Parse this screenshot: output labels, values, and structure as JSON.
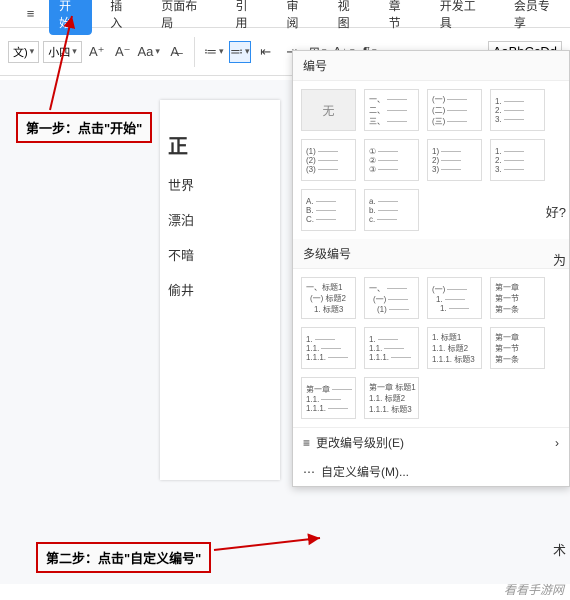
{
  "tabs": {
    "items": [
      "开始",
      "插入",
      "页面布局",
      "引用",
      "审阅",
      "视图",
      "章节",
      "开发工具",
      "会员专享"
    ],
    "active_index": 0
  },
  "ribbon": {
    "font_marker": "文)",
    "font_size": "小四",
    "increase_font": "A⁺",
    "decrease_font": "A⁻",
    "clear_format": "A",
    "style_preview": "AaBbCcDd"
  },
  "document": {
    "title_fragment": "正",
    "lines": [
      "世界",
      "漂泊",
      "不暗",
      "偷井"
    ],
    "right_fragments": [
      "好?",
      "为",
      "术"
    ]
  },
  "callouts": {
    "step1": "第一步：点击\"开始\"",
    "step2": "第二步：点击\"自定义编号\""
  },
  "panel": {
    "section1_title": "编号",
    "none_label": "无",
    "section2_title": "多级编号",
    "footer_change_level": "更改编号级别(E)",
    "footer_custom": "自定义编号(M)...",
    "thumbs_row1": [
      [
        "一、",
        "二、",
        "三、"
      ],
      [
        "(一)",
        "(二)",
        "(三)"
      ],
      [
        "1.",
        "2.",
        "3."
      ]
    ],
    "thumbs_row2": [
      [
        "(1)",
        "(2)",
        "(3)"
      ],
      [
        "①",
        "②",
        "③"
      ],
      [
        "1)",
        "2)",
        "3)"
      ],
      [
        "1.",
        "2.",
        "3."
      ]
    ],
    "thumbs_row3": [
      [
        "A.",
        "B.",
        "C."
      ],
      [
        "a.",
        "b.",
        "c."
      ]
    ],
    "multi_row1": [
      [
        "一、标题1",
        "(一) 标题2",
        "1. 标题3"
      ],
      [
        "一、",
        "(一)",
        "(1)"
      ],
      [
        "(一)",
        "1.",
        "1."
      ],
      [
        "第一章",
        "第一节",
        "第一条"
      ]
    ],
    "multi_row2": [
      [
        "1.",
        "1.1.",
        "1.1.1."
      ],
      [
        "1.",
        "1.1.",
        "1.1.1."
      ],
      [
        "1. 标题1",
        "1.1. 标题2",
        "1.1.1. 标题3"
      ],
      [
        "第一章",
        "第一节",
        "第一条"
      ]
    ],
    "multi_row3": [
      [
        "第一章",
        "1.1.",
        "1.1.1."
      ],
      [
        "第一章 标题1",
        "1.1. 标题2",
        "1.1.1. 标题3"
      ]
    ]
  },
  "watermark": "看看手游网"
}
